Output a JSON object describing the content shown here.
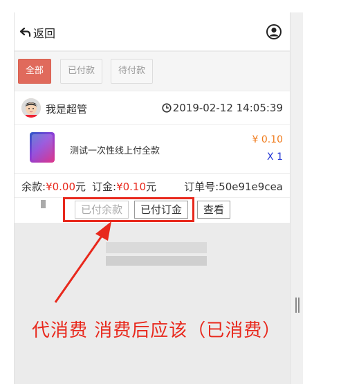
{
  "header": {
    "back_label": "返回"
  },
  "filters": [
    {
      "label": "全部"
    },
    {
      "label": "已付款"
    },
    {
      "label": "待付款"
    }
  ],
  "order": {
    "user_name": "我是超管",
    "time": "2019-02-12 14:05:39",
    "product_name": "测试一次性线上付全款",
    "price": "¥ 0.10",
    "qty": "X 1",
    "balance_label": "余款:",
    "balance_value": "¥0.00",
    "balance_unit": "元",
    "deposit_label": "订金:",
    "deposit_value": "¥0.10",
    "deposit_unit": "元",
    "order_no": "订单号:50e91e9cea",
    "actions": [
      "已付余款",
      "已付订金",
      "查看"
    ]
  },
  "annotation": {
    "text": "代消费  消费后应该（已消费）"
  },
  "colors": {
    "accent": "#e06a5c",
    "price_orange": "#f07a1a",
    "qty_blue": "#2a3cd6",
    "highlight_red": "#e8281c"
  }
}
